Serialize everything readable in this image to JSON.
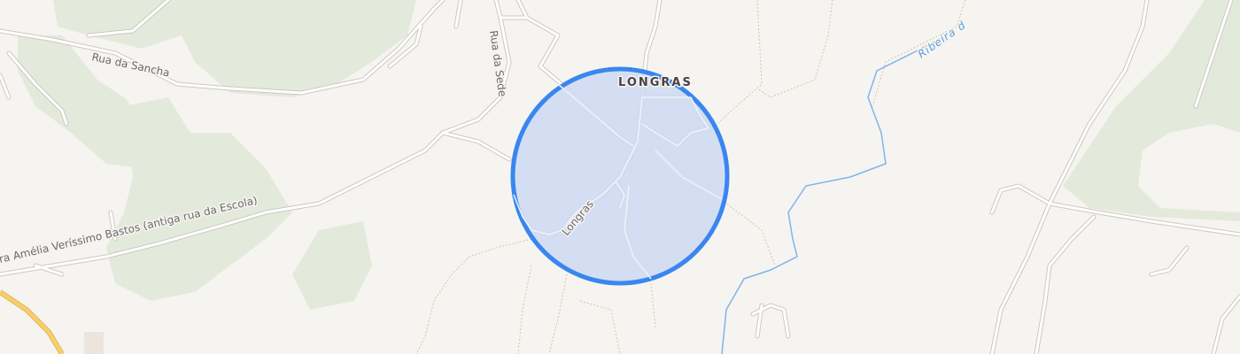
{
  "map": {
    "place_label": "LONGRAS",
    "streets": {
      "rua_da_sancha": "Rua da Sancha",
      "rua_da_sede": "Rua da Sede",
      "longras": "Longras",
      "amelia": "ra Amélia Veríssimo Bastos (antiga rua da Escola)"
    },
    "waterway": "Ribeira d",
    "colors": {
      "background": "#f6f4f0",
      "greenery": "#e4eadb",
      "roads": "#ffffff",
      "road_casing": "#cdc8c2",
      "main_road": "#f6cf6a",
      "river": "#7fb4ec",
      "location_circle_fill": "#cfdcf2",
      "location_circle_stroke": "#3a86f0"
    }
  }
}
